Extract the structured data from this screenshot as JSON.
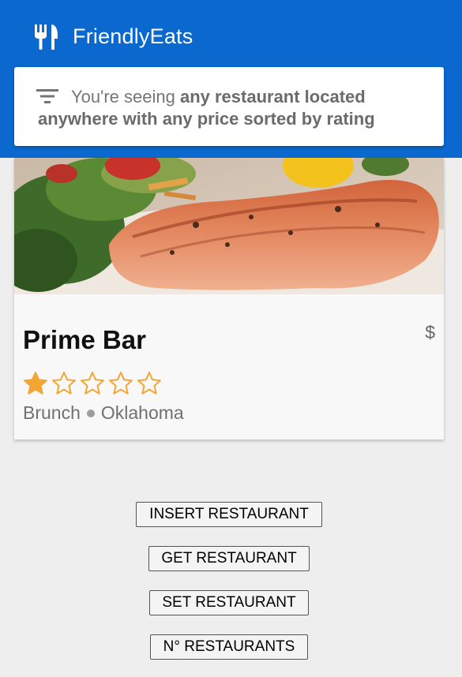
{
  "app": {
    "title": "FriendlyEats",
    "brand_color": "#0a68cf",
    "logo_icon": "restaurant-icon"
  },
  "filter": {
    "icon": "filter-list-icon",
    "prefix": "You're seeing ",
    "bold1": "any restaurant located",
    "bold2": "anywhere with any price sorted by rating"
  },
  "restaurant": {
    "name": "Prime Bar",
    "price": "$",
    "rating": 1,
    "max_rating": 5,
    "star_color": "#f4a634",
    "category": "Brunch",
    "city": "Oklahoma",
    "photo": "grilled-salmon-salad-photo"
  },
  "actions": {
    "insert": "INSERT RESTAURANT",
    "get": "GET RESTAURANT",
    "set": "SET RESTAURANT",
    "count": "N° RESTAURANTS"
  }
}
